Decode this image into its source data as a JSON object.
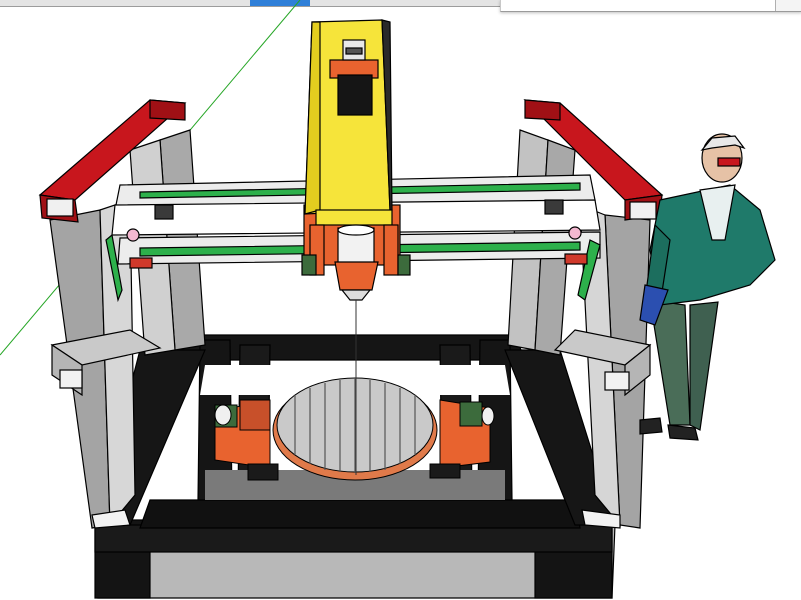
{
  "scene": {
    "description_text": "",
    "colors": {
      "frame_red": "#c8161d",
      "frame_gray": "#a7a7a7",
      "base_black": "#111111",
      "spindle_yellow": "#f6e43a",
      "mount_orange": "#e8632f",
      "rail_green": "#2db04b",
      "table_gray": "#bdbdbd",
      "axis_green": "#26a626"
    }
  },
  "toolbar_strips": [
    {
      "color": "#e8e8e8"
    },
    {
      "color": "#2f7fd8"
    }
  ]
}
